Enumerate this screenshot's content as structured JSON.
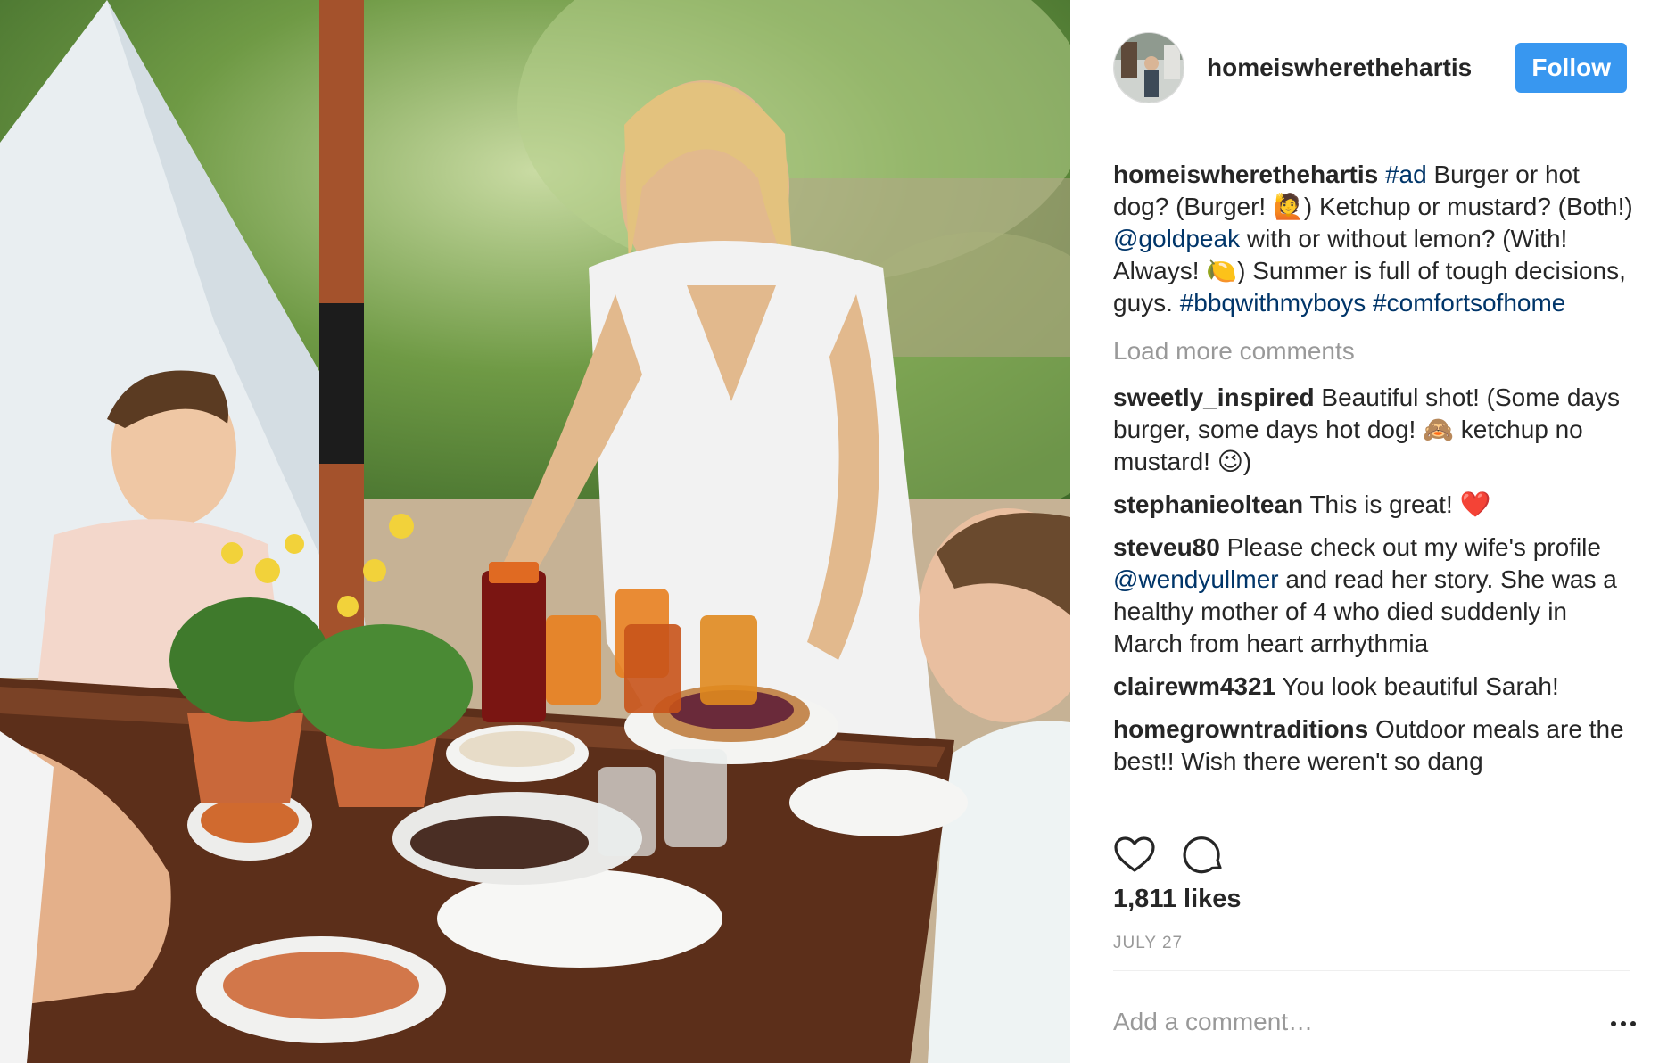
{
  "post": {
    "username": "homeiswherethehartis",
    "follow_label": "Follow",
    "photo_alt": "Family barbecue at an outdoor table with iced tea, pie and food"
  },
  "caption": {
    "username": "homeiswherethehartis",
    "parts": [
      {
        "t": "tag",
        "v": "#ad"
      },
      {
        "t": "text",
        "v": " Burger or hot dog? (Burger! "
      },
      {
        "t": "emoji",
        "v": "🙋"
      },
      {
        "t": "text",
        "v": ") Ketchup or mustard? (Both!) "
      },
      {
        "t": "tag",
        "v": "@goldpeak"
      },
      {
        "t": "text",
        "v": " with or without lemon? (With! Always! "
      },
      {
        "t": "emoji",
        "v": "🍋"
      },
      {
        "t": "text",
        "v": ") Summer is full of tough decisions, guys. "
      },
      {
        "t": "tag",
        "v": "#bbqwithmyboys"
      },
      {
        "t": "text",
        "v": " "
      },
      {
        "t": "tag",
        "v": "#comfortsofhome"
      }
    ]
  },
  "load_more_label": "Load more comments",
  "comments": [
    {
      "user": "sweetly_inspired",
      "parts": [
        {
          "t": "text",
          "v": " Beautiful shot! (Some days burger, some days hot dog! "
        },
        {
          "t": "emoji",
          "v": "🙈"
        },
        {
          "t": "text",
          "v": " ketchup no mustard! "
        },
        {
          "t": "emoji",
          "v": "😉"
        },
        {
          "t": "text",
          "v": ")"
        }
      ]
    },
    {
      "user": "stephanieoltean",
      "parts": [
        {
          "t": "text",
          "v": " This is great! "
        },
        {
          "t": "emoji",
          "v": "❤️"
        }
      ]
    },
    {
      "user": "steveu80",
      "parts": [
        {
          "t": "text",
          "v": " Please check out my wife's profile "
        },
        {
          "t": "tag",
          "v": "@wendyullmer"
        },
        {
          "t": "text",
          "v": " and read her story. She was a healthy mother of 4 who died suddenly in March from heart arrhythmia"
        }
      ]
    },
    {
      "user": "clairewm4321",
      "parts": [
        {
          "t": "text",
          "v": " You look beautiful Sarah!"
        }
      ]
    },
    {
      "user": "homegrowntraditions",
      "parts": [
        {
          "t": "text",
          "v": " Outdoor meals are the best!! Wish there weren't so dang"
        }
      ]
    }
  ],
  "likes_label": "1,811 likes",
  "date_label": "JULY 27",
  "add_comment_placeholder": "Add a comment…",
  "icons": {
    "like": "heart-outline-icon",
    "comment": "speech-bubble-icon",
    "more": "ellipsis-icon"
  },
  "colors": {
    "follow_bg": "#3897f0",
    "link": "#003569",
    "muted": "#999999",
    "text": "#262626",
    "heart_red": "#ed4956"
  }
}
